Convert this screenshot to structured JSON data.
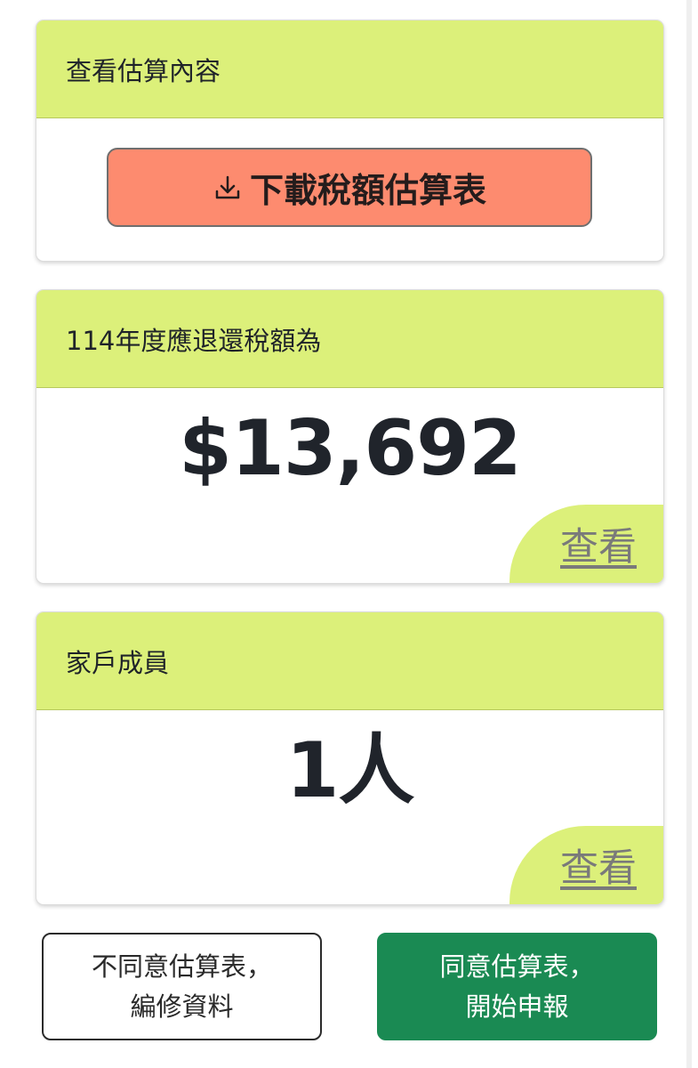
{
  "estimate_card": {
    "title": "查看估算內容",
    "download_label": "下載稅額估算表",
    "download_icon": "download-icon"
  },
  "refund_card": {
    "title": "114年度應退還稅額為",
    "amount": "$13,692",
    "view_label": "查看"
  },
  "household_card": {
    "title": "家戶成員",
    "count": "1人",
    "view_label": "查看"
  },
  "actions": {
    "disagree_line1": "不同意估算表，",
    "disagree_line2": "編修資料",
    "agree_line1": "同意估算表，",
    "agree_line2": "開始申報"
  },
  "colors": {
    "header_bg": "#dcf07a",
    "download_button_bg": "#fd8b6f",
    "agree_button_bg": "#1a8a53"
  }
}
